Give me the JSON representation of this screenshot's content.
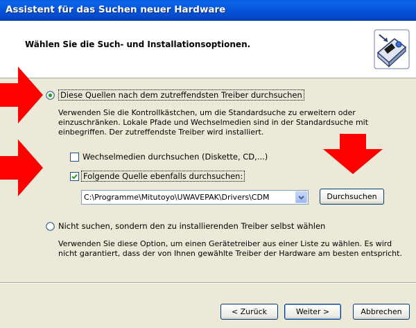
{
  "window": {
    "title": "Assistent für das Suchen neuer Hardware"
  },
  "header": {
    "title": "Wählen Sie die Such- und Installationsoptionen."
  },
  "options": {
    "search": {
      "label": "Diese Quellen nach dem zutreffendsten Treiber durchsuchen",
      "selected": true,
      "description": "Verwenden Sie die Kontrollkästchen, um die Standardsuche zu erweitern oder einzuschränken. Lokale Pfade und Wechselmedien sind in der Standardsuche mit einbegriffen. Der zutreffendste Treiber wird installiert."
    },
    "removable": {
      "label": "Wechselmedien durchsuchen (Diskette, CD,...)",
      "checked": false
    },
    "include_path": {
      "label": "Folgende Quelle ebenfalls durchsuchen:",
      "checked": true
    },
    "path": {
      "value": "C:\\Programme\\Mitutoyo\\UWAVEPAK\\Drivers\\CDM"
    },
    "browse_button": "Durchsuchen",
    "manual": {
      "label": "Nicht suchen, sondern den zu installierenden Treiber selbst wählen",
      "selected": false,
      "description": "Verwenden Sie diese Option, um einen Gerätetreiber aus einer Liste zu wählen. Es wird nicht garantiert, dass der von Ihnen gewählte Treiber der Hardware am besten entspricht."
    }
  },
  "footer": {
    "back_button": "< Zurück",
    "next_button": "Weiter >",
    "cancel_button": "Abbrechen"
  },
  "colors": {
    "titlebar": "#0453d8",
    "dialog_bg": "#ece9d8",
    "annotation_arrow": "#ff0000",
    "checkbox_check": "#21a121",
    "radio_dot": "#21a121"
  },
  "icons": {
    "header": "hardware-install-icon",
    "annotations": "red-arrow-icon"
  }
}
